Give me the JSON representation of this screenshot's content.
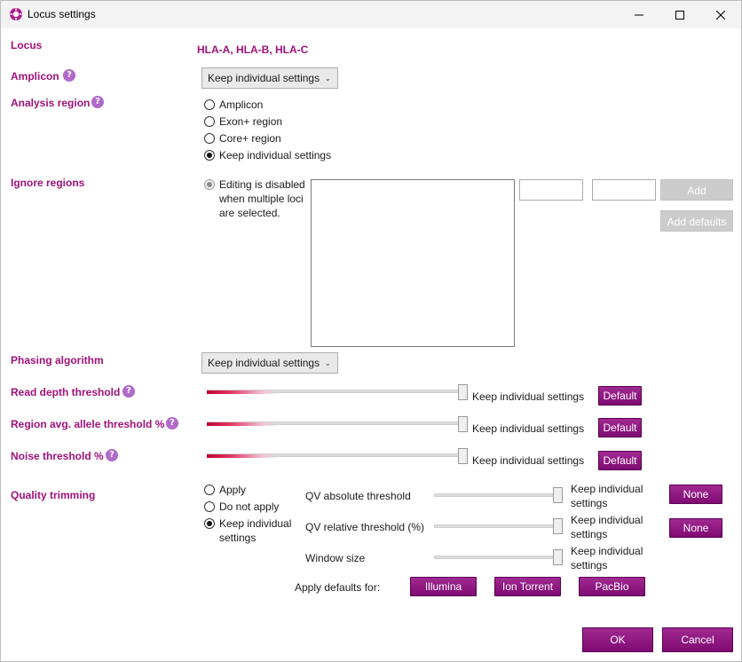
{
  "window": {
    "title": "Locus settings"
  },
  "locus": {
    "label": "Locus",
    "value": "HLA-A, HLA-B, HLA-C"
  },
  "amplicon": {
    "label": "Amplicon",
    "selected": "Keep individual settings"
  },
  "analysis_region": {
    "label": "Analysis region",
    "options": [
      "Amplicon",
      "Exon+ region",
      "Core+ region",
      "Keep individual settings"
    ],
    "selected_index": 3
  },
  "ignore_regions": {
    "label": "Ignore regions",
    "disabled_line1": "Editing is disabled",
    "disabled_line2": "when multiple loci",
    "disabled_line3": "are selected.",
    "start_value": "",
    "end_value": "",
    "add_label": "Add",
    "add_defaults_label": "Add defaults"
  },
  "phasing": {
    "label": "Phasing algorithm",
    "selected": "Keep individual settings"
  },
  "sliders": [
    {
      "label": "Read depth threshold",
      "value_text": "Keep individual settings",
      "button": "Default",
      "level": 1.0
    },
    {
      "label": "Region avg. allele threshold %",
      "value_text": "Keep individual settings",
      "button": "Default",
      "level": 1.0
    },
    {
      "label": "Noise threshold %",
      "value_text": "Keep individual settings",
      "button": "Default",
      "level": 1.0
    }
  ],
  "quality_trimming": {
    "label": "Quality trimming",
    "options": [
      "Apply",
      "Do not apply",
      "Keep individual",
      "settings"
    ],
    "selected_index": 2,
    "params": [
      {
        "label": "QV absolute threshold",
        "line1": "Keep individual",
        "line2": "settings",
        "button": "None",
        "level": 1.0
      },
      {
        "label": "QV relative threshold (%)",
        "line1": "Keep individual",
        "line2": "settings",
        "button": "None",
        "level": 1.0
      },
      {
        "label": "Window size",
        "line1": "Keep individual",
        "line2": "settings",
        "button": "",
        "level": 1.0
      }
    ],
    "apply_defaults_label": "Apply defaults for:",
    "presets": [
      "Illumina",
      "Ion Torrent",
      "PacBio"
    ]
  },
  "footer": {
    "ok": "OK",
    "cancel": "Cancel"
  },
  "colors": {
    "accent": "#a0127a",
    "button": "#8e1a82",
    "slider_fill": "#c1003a"
  },
  "help_glyph": "?"
}
